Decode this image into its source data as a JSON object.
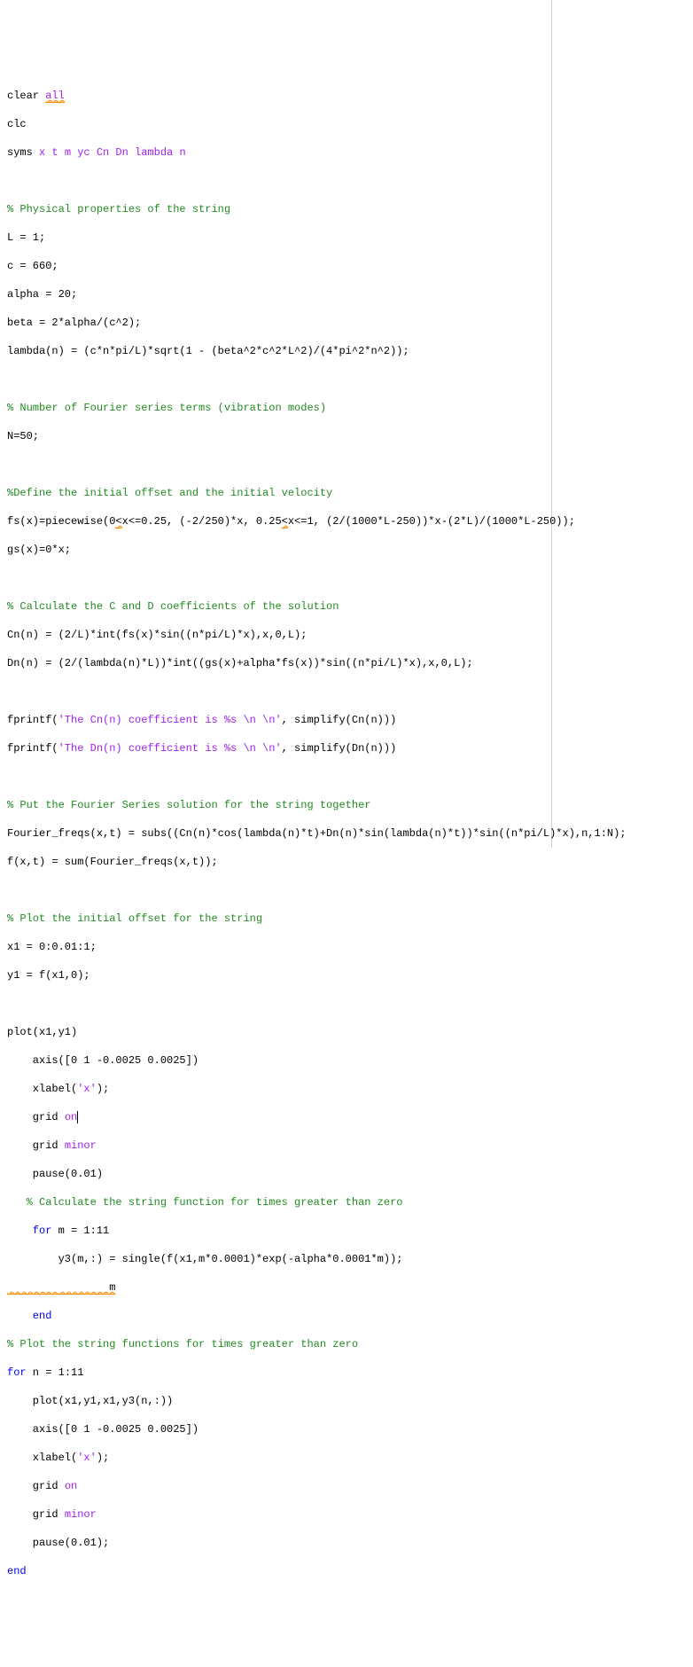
{
  "code": {
    "l01a": "clear ",
    "l01b": "all",
    "l02": "clc",
    "l03a": "syms ",
    "l03b": "x t m yc Cn Dn lambda n",
    "l05": "% Physical properties of the string",
    "l06": "L = 1;",
    "l07": "c = 660;",
    "l08": "alpha = 20;",
    "l09": "beta = 2*alpha/(c^2);",
    "l10": "lambda(n) = (c*n*pi/L)*sqrt(1 - (beta^2*c^2*L^2)/(4*pi^2*n^2));",
    "l12": "% Number of Fourier series terms (vibration modes)",
    "l13": "N=50;",
    "l15": "%Define the initial offset and the initial velocity",
    "l16a": "fs(x)=piecewise(0",
    "l16b": "<",
    "l16c": "x<=0.25, (-2/250)*x, 0.25",
    "l16d": "<",
    "l16e": "x<=1, (2/(1000*L-250))*x-(2*L)/(1000*L-250));",
    "l17": "gs(x)=0*x;",
    "l19": "% Calculate the C and D coefficients of the solution",
    "l20": "Cn(n) = (2/L)*int(fs(x)*sin((n*pi/L)*x),x,0,L);",
    "l21": "Dn(n) = (2/(lambda(n)*L))*int((gs(x)+alpha*fs(x))*sin((n*pi/L)*x),x,0,L);",
    "l23a": "fprintf(",
    "l23b": "'The Cn(n) coefficient is %s \\n \\n'",
    "l23c": ", simplify(Cn(n)))",
    "l24a": "fprintf(",
    "l24b": "'The Dn(n) coefficient is %s \\n \\n'",
    "l24c": ", simplify(Dn(n)))",
    "l26": "% Put the Fourier Series solution for the string together",
    "l27": "Fourier_freqs(x,t) = subs((Cn(n)*cos(lambda(n)*t)+Dn(n)*sin(lambda(n)*t))*sin((n*pi/L)*x),n,1:N);",
    "l28": "f(x,t) = sum(Fourier_freqs(x,t));",
    "l30": "% Plot the initial offset for the string",
    "l31": "x1 = 0:0.01:1;",
    "l32": "y1 = f(x1,0);",
    "l34": "plot(x1,y1)",
    "l35": "    axis([0 1 -0.0025 0.0025])",
    "l36a": "    xlabel(",
    "l36b": "'x'",
    "l36c": ");",
    "l37a": "    grid ",
    "l37b": "on",
    "l38a": "    grid ",
    "l38b": "minor",
    "l39": "    pause(0.01)",
    "l40": "   % Calculate the string function for times greater than zero",
    "l41a": "    for",
    "l41b": " m = 1:11",
    "l42": "        y3(m,:) = single(f(x1,m*0.0001)*exp(-alpha*0.0001*m));",
    "l43": "        m",
    "l44": "    end",
    "l45": "% Plot the string functions for times greater than zero",
    "l46a": "for",
    "l46b": " n = 1:11",
    "l47": "    plot(x1,y1,x1,y3(n,:))",
    "l48": "    axis([0 1 -0.0025 0.0025])",
    "l49a": "    xlabel(",
    "l49b": "'x'",
    "l49c": ");",
    "l50a": "    grid ",
    "l50b": "on",
    "l51a": "    grid ",
    "l51b": "minor",
    "l52": "    pause(0.01);",
    "l53": "end"
  },
  "fold": {
    "close": "]",
    "open": "-",
    "dash": "-"
  }
}
